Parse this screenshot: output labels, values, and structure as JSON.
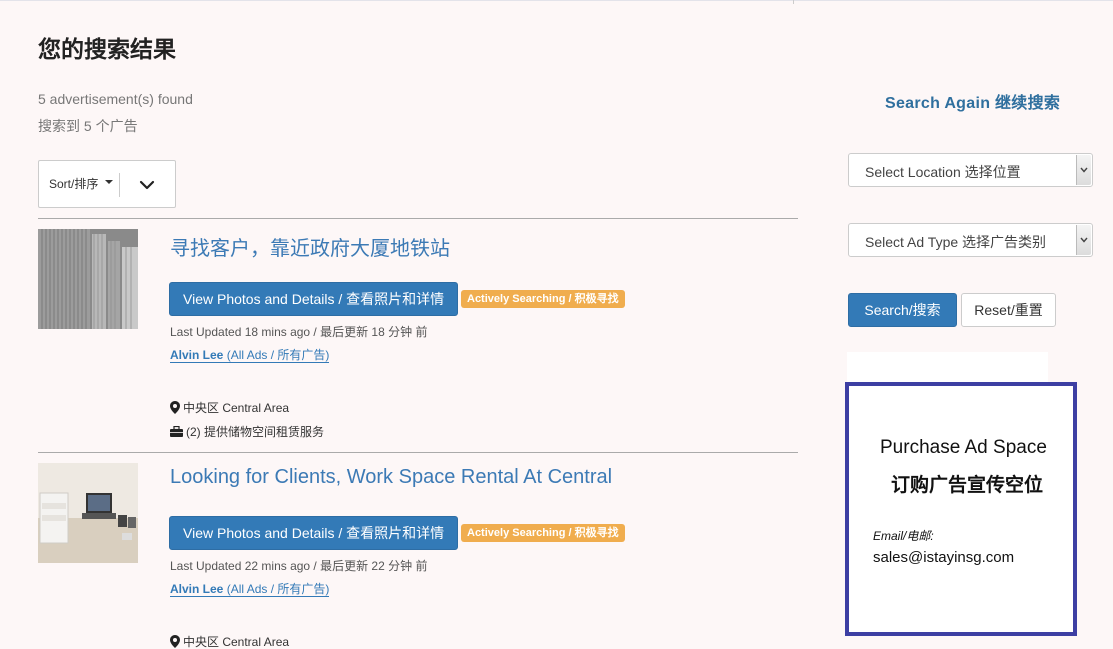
{
  "page": {
    "title": "您的搜索结果",
    "found_en": "5 advertisement(s) found",
    "found_cn": "搜索到 5 个广告"
  },
  "sort": {
    "label": "Sort/排序"
  },
  "listings": [
    {
      "title": "寻找客户，靠近政府大厦地铁站",
      "view_label": "View Photos and Details / 查看照片和详情",
      "badge": "Actively Searching / 积极寻找",
      "updated": "Last Updated 18 mins ago / 最后更新 18 分钟 前",
      "author": "Alvin Lee",
      "author_all": "(All Ads / 所有广告)",
      "location": "中央区 Central Area",
      "category": "(2) 提供储物空间租赁服务"
    },
    {
      "title": "Looking for Clients, Work Space Rental At Central",
      "view_label": "View Photos and Details / 查看照片和详情",
      "badge": "Actively Searching / 积极寻找",
      "updated": "Last Updated 22 mins ago / 最后更新 22 分钟 前",
      "author": "Alvin Lee",
      "author_all": "(All Ads / 所有广告)",
      "location": "中央区 Central Area"
    }
  ],
  "sidebar": {
    "search_again": "Search Again 继续搜索",
    "location_select": "Select Location 选择位置",
    "adtype_select": "Select Ad Type 选择广告类别",
    "search_button": "Search/搜索",
    "reset_button": "Reset/重置"
  },
  "ad": {
    "title_en": "Purchase Ad Space",
    "title_cn": "订购广告宣传空位",
    "email_label": "Email/电邮:",
    "email": "sales@istayinsg.com"
  },
  "colors": {
    "primary": "#337ab7",
    "badge": "#f0ad4e",
    "link": "#3c7ab5",
    "ad_border": "#3d3fa3",
    "page_bg": "#fdf7f7"
  }
}
